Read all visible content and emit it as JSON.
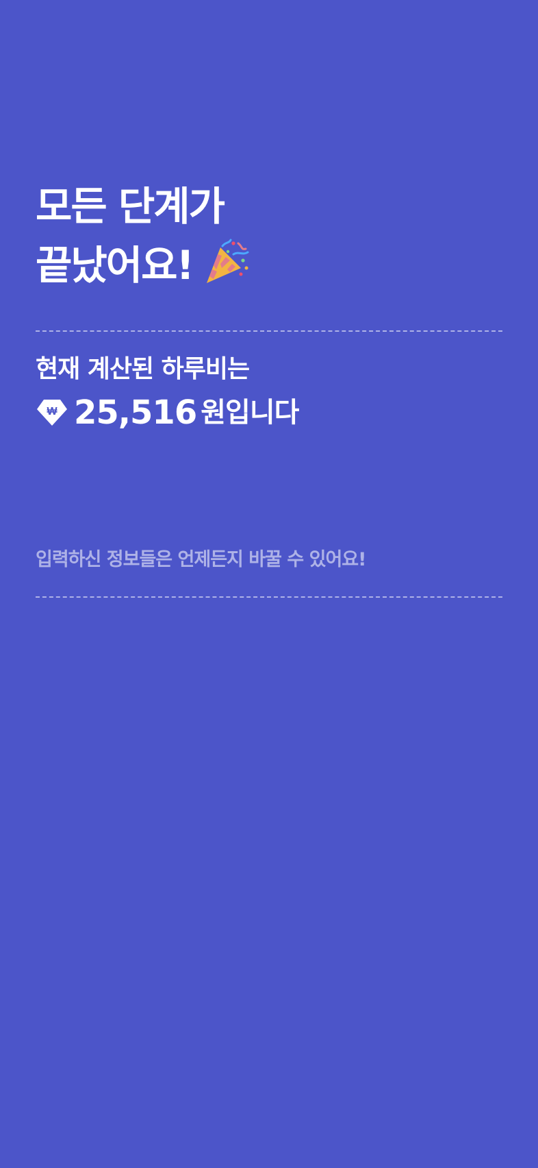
{
  "screen": {
    "title_line1": "모든 단계가",
    "title_line2": "끝났어요!",
    "title_icon": "party-popper-icon",
    "subtitle": "현재 계산된 하루비는",
    "amount_icon": "won-diamond-icon",
    "amount_value": "25,516",
    "amount_unit": "원입니다",
    "notice": "입력하신 정보들은 언제든지 바꿀 수 있어요!"
  },
  "colors": {
    "background": "#4C55C9",
    "text": "#FFFFFF",
    "muted_text": "#9EA3E6"
  }
}
